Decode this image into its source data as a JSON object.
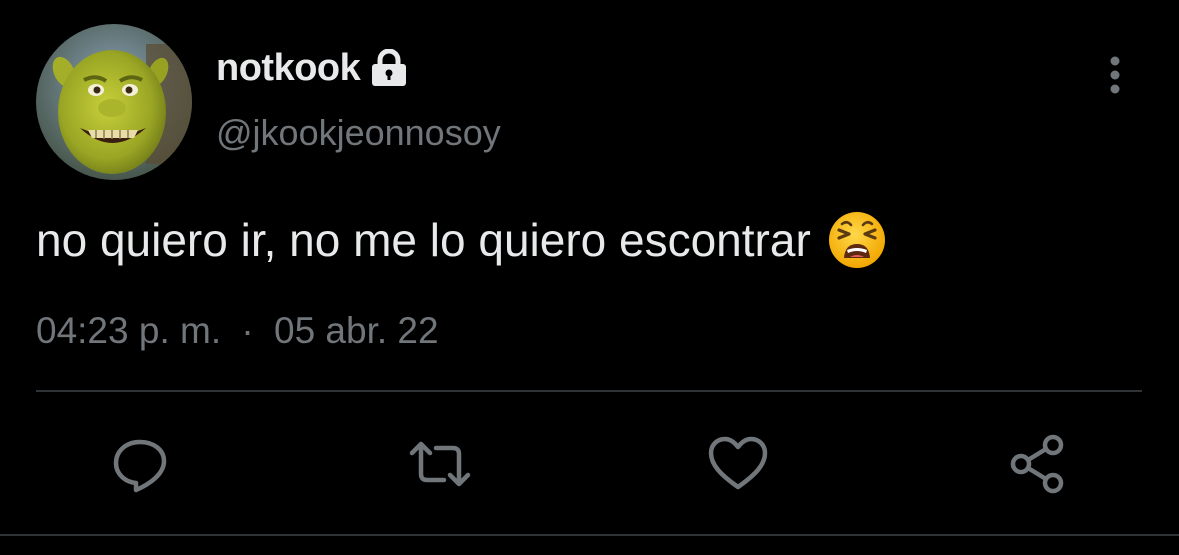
{
  "tweet": {
    "author": {
      "name": "notkook",
      "handle": "@jkookjeonnosoy",
      "protected": true
    },
    "text": "no quiero ir, no me lo quiero escontrar",
    "emoji": "weary-face-emoji",
    "timestamp": {
      "time": "04:23 p. m.",
      "separator": "·",
      "date": "05 abr. 22"
    }
  },
  "actions": {
    "reply_icon": "reply-icon",
    "retweet_icon": "retweet-icon",
    "like_icon": "heart-icon",
    "share_icon": "share-icon"
  },
  "colors": {
    "background": "#000000",
    "primary_text": "#e7e9ea",
    "secondary_text": "#71767b",
    "divider": "#2f3336"
  }
}
